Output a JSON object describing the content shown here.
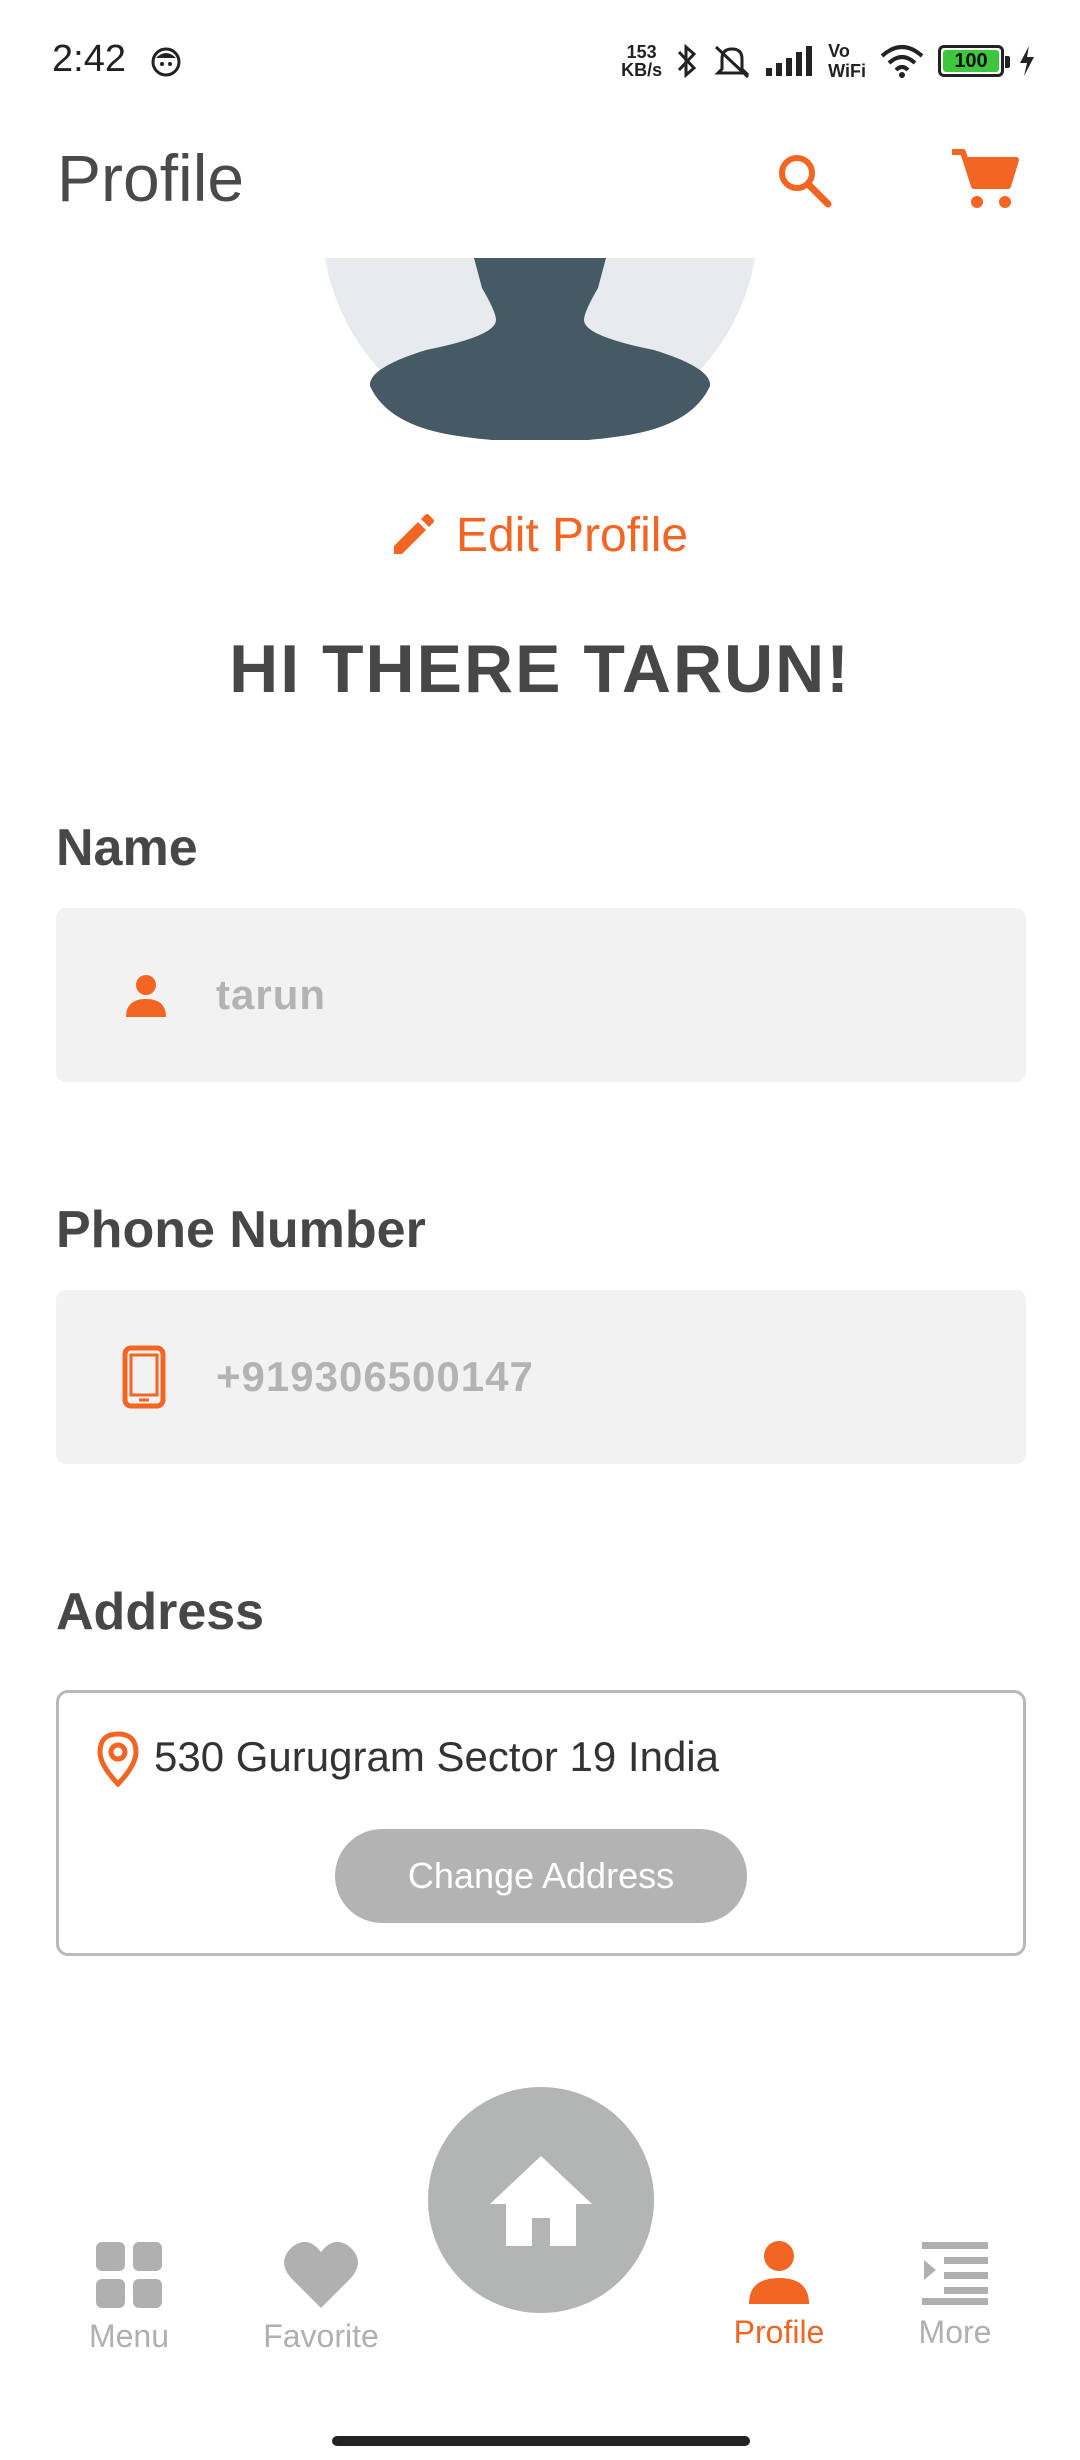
{
  "status_bar": {
    "time": "2:42",
    "net_speed_value": "153",
    "net_speed_unit": "KB/s",
    "vo": "Vo",
    "wifi_label": "WiFi",
    "battery": "100"
  },
  "app_bar": {
    "title": "Profile"
  },
  "profile": {
    "edit_label": "Edit Profile",
    "greeting": "HI THERE TARUN!"
  },
  "fields": {
    "name_label": "Name",
    "name_value": "tarun",
    "phone_label": "Phone Number",
    "phone_value": "+919306500147",
    "address_label": "Address",
    "address_value": "530 Gurugram Sector 19 India",
    "change_address_label": "Change Address"
  },
  "bottom_nav": {
    "items": [
      {
        "label": "Menu",
        "icon": "grid-icon"
      },
      {
        "label": "Favorite",
        "icon": "heart-icon"
      },
      {
        "label": "Profile",
        "icon": "person-icon"
      },
      {
        "label": "More",
        "icon": "list-indent-icon"
      }
    ],
    "center_icon": "home-icon",
    "active": "Profile"
  },
  "colors": {
    "accent": "#f26522",
    "inactive": "#b0b0b0",
    "text_dark": "#474747",
    "field_bg": "#f2f2f2"
  }
}
